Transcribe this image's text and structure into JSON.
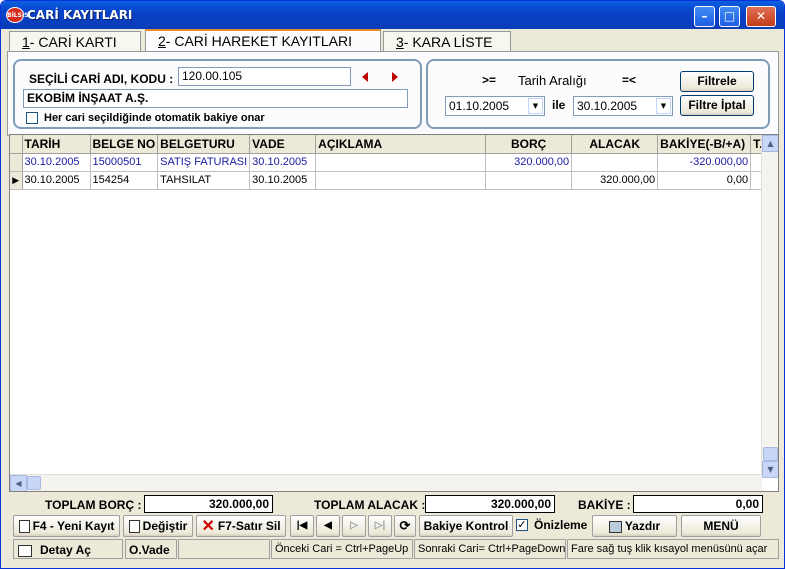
{
  "window": {
    "title": "CARİ KAYITLARI",
    "app_icon_text": "BİLSİS",
    "minimize": "–",
    "maximize": "□",
    "close": "✕"
  },
  "tabs": [
    {
      "key": "1",
      "label": "- CARİ KARTI"
    },
    {
      "key": "2",
      "label": "- CARİ HAREKET KAYITLARI"
    },
    {
      "key": "3",
      "label": "- KARA LİSTE"
    }
  ],
  "filter": {
    "cari_label": "SEÇİLİ CARİ ADI, KODU :",
    "cari_code": "120.00.105",
    "cari_name": "EKOBİM İNŞAAT A.Ş.",
    "auto_balance_label": "Her cari seçildiğinde otomatik bakiye onar",
    "auto_balance_checked": false,
    "gte": ">=",
    "range_label": "Tarih Aralığı",
    "lte": "=<",
    "date_from": "01.10.2005",
    "ile": "ile",
    "date_to": "30.10.2005",
    "filter_button": "Filtrele",
    "filter_cancel_button": "Filtre İptal"
  },
  "grid": {
    "columns": [
      "TARİH",
      "BELGE NO",
      "BELGETURU",
      "VADE",
      "AÇIKLAMA",
      "BORÇ",
      "ALACAK",
      "BAKİYE(-B/+A)",
      "T."
    ],
    "rows": [
      {
        "tarih": "30.10.2005",
        "belge_no": "15000501",
        "belge_turu": "SATIŞ FATURASI",
        "vade": "30.10.2005",
        "aciklama": "",
        "borc": "320.000,00",
        "alacak": "",
        "bakiye": "-320.000,00"
      },
      {
        "tarih": "30.10.2005",
        "belge_no": "154254",
        "belge_turu": "TAHSILAT",
        "vade": "30.10.2005",
        "aciklama": "",
        "borc": "",
        "alacak": "320.000,00",
        "bakiye": "0,00"
      }
    ]
  },
  "totals": {
    "borc_label": "TOPLAM BORÇ :",
    "borc_value": "320.000,00",
    "alacak_label": "TOPLAM ALACAK :",
    "alacak_value": "320.000,00",
    "bakiye_label": "BAKİYE :",
    "bakiye_value": "0,00"
  },
  "toolbar": {
    "new_record": "F4 - Yeni Kayıt",
    "edit": "Değiştir",
    "delete_row": "F7-Satır Sil",
    "balance_check": "Bakiye Kontrol",
    "preview": "Önizleme",
    "preview_checked": true,
    "print": "Yazdır",
    "menu": "MENÜ"
  },
  "statusbar": {
    "detail_open": "Detay Aç",
    "o_vade": "O.Vade",
    "prev_hint": "Önceki Cari = Ctrl+PageUp",
    "next_hint": "Sonraki Cari= Ctrl+PageDown",
    "mouse_hint": "Fare sağ tuş klik kısayol menüsünü açar"
  }
}
